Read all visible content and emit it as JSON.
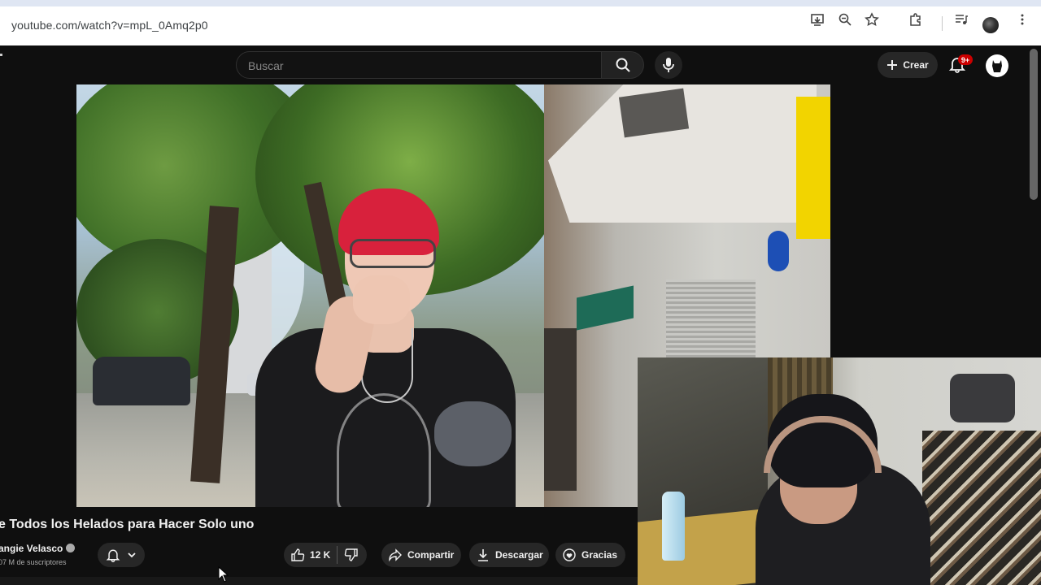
{
  "browser": {
    "url": "youtube.com/watch?v=mpL_0Amq2p0",
    "icons": [
      "install-app-icon",
      "zoom-icon",
      "bookmark-star-icon",
      "extensions-icon",
      "media-queue-icon",
      "profile-avatar",
      "menu-kebab-icon"
    ]
  },
  "header": {
    "search_placeholder": "Buscar",
    "create_label": "Crear",
    "notification_badge": "9+"
  },
  "video": {
    "title": "e Todos los Helados para Hacer Solo uno",
    "channel": "angie Velasco",
    "subscribers": "07 M de suscriptores"
  },
  "actions": {
    "likes": "12 K",
    "share_label": "Compartir",
    "download_label": "Descargar",
    "thanks_label": "Gracias"
  },
  "colors": {
    "background": "#0f0f0f",
    "pill": "#272727",
    "badge": "#cc0000"
  }
}
